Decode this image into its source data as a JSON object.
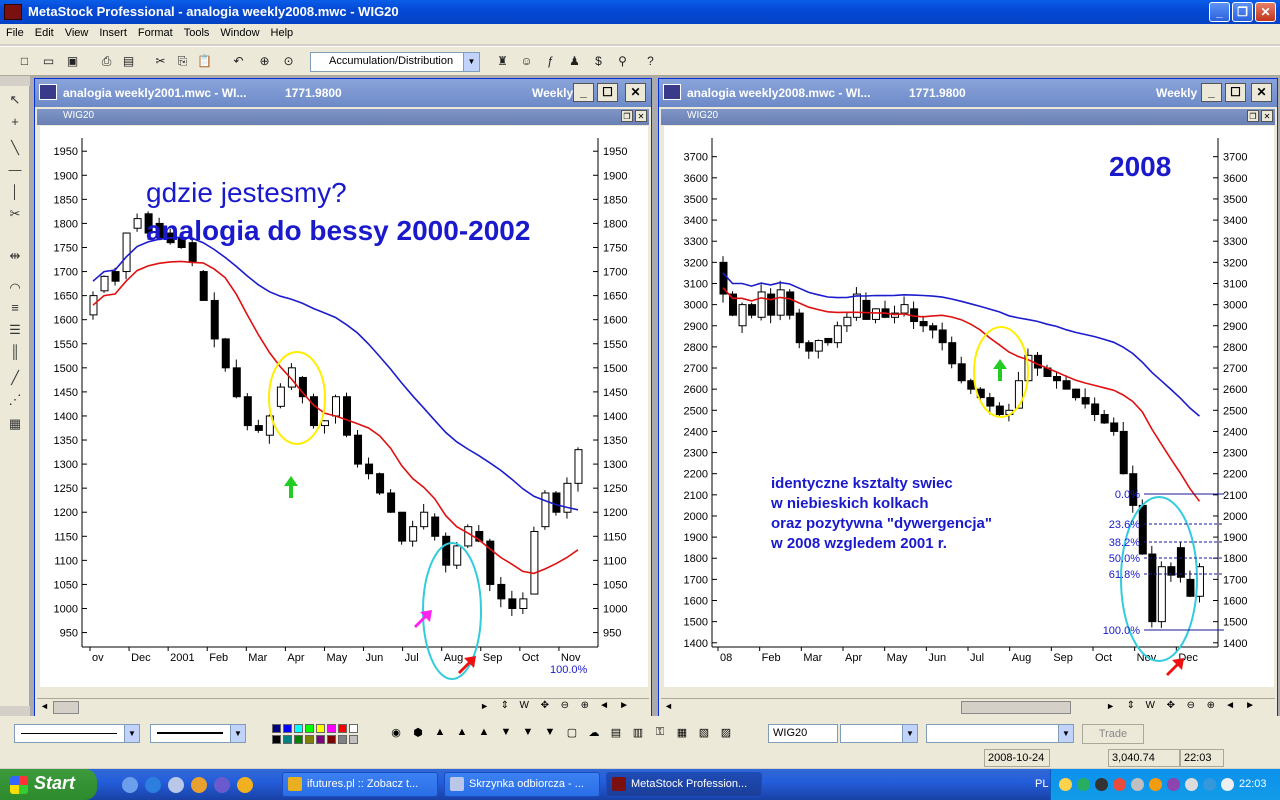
{
  "app": {
    "title": "MetaStock Professional - analogia weekly2008.mwc - WIG20"
  },
  "menu": [
    "File",
    "Edit",
    "View",
    "Insert",
    "Format",
    "Tools",
    "Window",
    "Help"
  ],
  "toolbar": {
    "indicator": "Accumulation/Distribution"
  },
  "left_chart": {
    "window_title": "analogia weekly2001.mwc - WI...",
    "price": "1771.9800",
    "period": "Weekly",
    "symbol": "WIG20",
    "annotation_line1": "gdzie jestesmy?",
    "annotation_line2": "analogia do bessy 2000-2002",
    "label_100_blue": "100.0%",
    "label_100_green": "100.0%",
    "y_ticks": [
      "1950",
      "1900",
      "1850",
      "1800",
      "1750",
      "1700",
      "1650",
      "1600",
      "1550",
      "1500",
      "1450",
      "1400",
      "1350",
      "1300",
      "1250",
      "1200",
      "1150",
      "1100",
      "1050",
      "1000",
      "950"
    ],
    "x_ticks": [
      "ov",
      "Dec",
      "2001",
      "Feb",
      "Mar",
      "Apr",
      "May",
      "Jun",
      "Jul",
      "Aug",
      "Sep",
      "Oct",
      "Nov"
    ]
  },
  "right_chart": {
    "window_title": "analogia weekly2008.mwc - WI...",
    "price": "1771.9800",
    "period": "Weekly",
    "symbol": "WIG20",
    "year_label": "2008",
    "note": [
      "identyczne ksztalty swiec",
      "w niebieskich kolkach",
      "oraz pozytywna \"dywergencja\"",
      "w 2008 wzgledem 2001 r."
    ],
    "fib": [
      "0.0%",
      "23.6%",
      "38.2%",
      "50.0%",
      "61.8%",
      "100.0%"
    ],
    "y_ticks": [
      "3700",
      "3600",
      "3500",
      "3400",
      "3300",
      "3200",
      "3100",
      "3000",
      "2900",
      "2800",
      "2700",
      "2600",
      "2500",
      "2400",
      "2300",
      "2200",
      "2100",
      "2000",
      "1900",
      "1800",
      "1700",
      "1600",
      "1500",
      "1400"
    ],
    "x_ticks": [
      "08",
      "Feb",
      "Mar",
      "Apr",
      "May",
      "Jun",
      "Jul",
      "Aug",
      "Sep",
      "Oct",
      "Nov",
      "Dec"
    ]
  },
  "bottom": {
    "symbol_field": "WIG20",
    "trade_button": "Trade"
  },
  "status": {
    "date": "2008-10-24",
    "value": "3,040.74",
    "time": "22:03"
  },
  "taskbar": {
    "start": "Start",
    "tasks": [
      "ifutures.pl :: Zobacz t...",
      "Skrzynka odbiorcza - ...",
      "MetaStock Profession..."
    ],
    "lang": "PL",
    "clock": "22:03"
  },
  "colors": {
    "candle_up": "#ffffff",
    "candle_down": "#000000",
    "ma_short": "#e01010",
    "ma_long": "#1c1ccc",
    "annotation": "#1a1acc",
    "circle_yellow": "#ffee00",
    "circle_cyan": "#33ccdd"
  },
  "icons": [
    "new-icon",
    "open-icon",
    "save-icon",
    "print-icon",
    "cut-icon",
    "copy-icon",
    "paste-icon",
    "crosshair-icon",
    "zoom-icon",
    "search-icon",
    "help-icon"
  ]
}
